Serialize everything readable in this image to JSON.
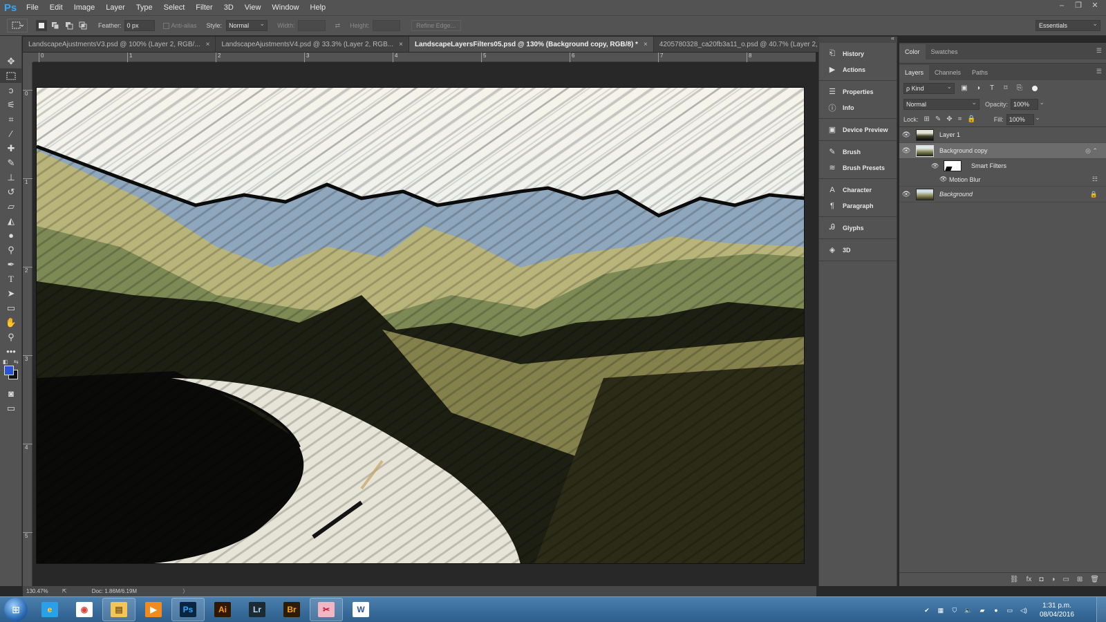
{
  "app": {
    "logo": "Ps",
    "menu": [
      "File",
      "Edit",
      "Image",
      "Layer",
      "Type",
      "Select",
      "Filter",
      "3D",
      "View",
      "Window",
      "Help"
    ],
    "window_controls": [
      "–",
      "❐",
      "✕"
    ]
  },
  "options_bar": {
    "feather_label": "Feather:",
    "feather_value": "0 px",
    "anti_alias_label": "Anti-alias",
    "style_label": "Style:",
    "style_value": "Normal",
    "width_label": "Width:",
    "height_label": "Height:",
    "refine_edge_label": "Refine Edge...",
    "workspace": "Essentials"
  },
  "tabs": [
    {
      "label": "LandscapeAjustmentsV3.psd @ 100% (Layer 2, RGB/...",
      "close": "×"
    },
    {
      "label": "LandscapeAjustmentsV4.psd @ 33.3% (Layer 2, RGB...",
      "close": "×"
    },
    {
      "label": "LandscapeLayersFilters05.psd @ 130% (Background copy, RGB/8) *",
      "close": "×"
    },
    {
      "label": "4205780328_ca20fb3a11_o.psd @ 40.7% (Layer 2, RGB...",
      "close": "×"
    }
  ],
  "rulers": {
    "horizontal": [
      "0",
      "1",
      "2",
      "3",
      "4",
      "5",
      "6",
      "7",
      "8"
    ],
    "vertical": [
      "0",
      "1",
      "2",
      "3",
      "4",
      "5"
    ]
  },
  "status": {
    "zoom": "130.47%",
    "doc": "Doc: 1.86M/6.19M",
    "arrow": "〉"
  },
  "dock": {
    "groups": [
      [
        {
          "icon": "history-icon",
          "glyph": "⎗",
          "label": "History"
        },
        {
          "icon": "actions-icon",
          "glyph": "▶",
          "label": "Actions"
        }
      ],
      [
        {
          "icon": "properties-icon",
          "glyph": "☰",
          "label": "Properties"
        },
        {
          "icon": "info-icon",
          "glyph": "ⓘ",
          "label": "Info"
        }
      ],
      [
        {
          "icon": "device-preview-icon",
          "glyph": "▣",
          "label": "Device Preview"
        }
      ],
      [
        {
          "icon": "brush-icon",
          "glyph": "✎",
          "label": "Brush"
        },
        {
          "icon": "brush-presets-icon",
          "glyph": "≋",
          "label": "Brush Presets"
        }
      ],
      [
        {
          "icon": "character-icon",
          "glyph": "A",
          "label": "Character"
        },
        {
          "icon": "paragraph-icon",
          "glyph": "¶",
          "label": "Paragraph"
        }
      ],
      [
        {
          "icon": "glyphs-icon",
          "glyph": "Ꭿ",
          "label": "Glyphs"
        }
      ],
      [
        {
          "icon": "3d-icon",
          "glyph": "◈",
          "label": "3D"
        }
      ]
    ]
  },
  "color_panel": {
    "tabs": [
      "Color",
      "Swatches"
    ]
  },
  "layers_panel": {
    "tabs": [
      "Layers",
      "Channels",
      "Paths"
    ],
    "kind": "ρ Kind",
    "blend_mode": "Normal",
    "opacity_label": "Opacity:",
    "opacity_value": "100%",
    "lock_label": "Lock:",
    "fill_label": "Fill:",
    "fill_value": "100%",
    "layers": [
      {
        "name": "Layer 1"
      },
      {
        "name": "Background copy"
      },
      {
        "name": "Background"
      }
    ],
    "smart_filters_label": "Smart Filters",
    "motion_blur_label": "Motion Blur",
    "bottom_icons": [
      "⛓",
      "fx",
      "◘",
      "◑",
      "▭",
      "⊞",
      "🗑"
    ]
  },
  "taskbar": {
    "apps": [
      {
        "name": "Internet Explorer",
        "glyph": "e",
        "color": "#2aa0e8",
        "fg": "#ffd23f"
      },
      {
        "name": "Chrome",
        "glyph": "◉",
        "color": "#ffffff",
        "fg": "#db4437"
      },
      {
        "name": "Explorer",
        "glyph": "▤",
        "color": "#f3c556",
        "fg": "#7b5a1e"
      },
      {
        "name": "Media Player",
        "glyph": "▶",
        "color": "#f28b1d",
        "fg": "#ffffff"
      },
      {
        "name": "Photoshop",
        "glyph": "Ps",
        "color": "#0a2540",
        "fg": "#31a8ff"
      },
      {
        "name": "Illustrator",
        "glyph": "Ai",
        "color": "#2f1800",
        "fg": "#ff9a00"
      },
      {
        "name": "Lightroom",
        "glyph": "Lr",
        "color": "#1c2a33",
        "fg": "#b8d9f0"
      },
      {
        "name": "Bridge",
        "glyph": "Br",
        "color": "#2d1c00",
        "fg": "#f5a623"
      },
      {
        "name": "Snipping Tool",
        "glyph": "✂",
        "color": "#f1b6c3",
        "fg": "#c0102c"
      },
      {
        "name": "Word",
        "glyph": "W",
        "color": "#ffffff",
        "fg": "#2b5797"
      }
    ],
    "time": "1:31 p.m.",
    "date": "08/04/2016"
  }
}
